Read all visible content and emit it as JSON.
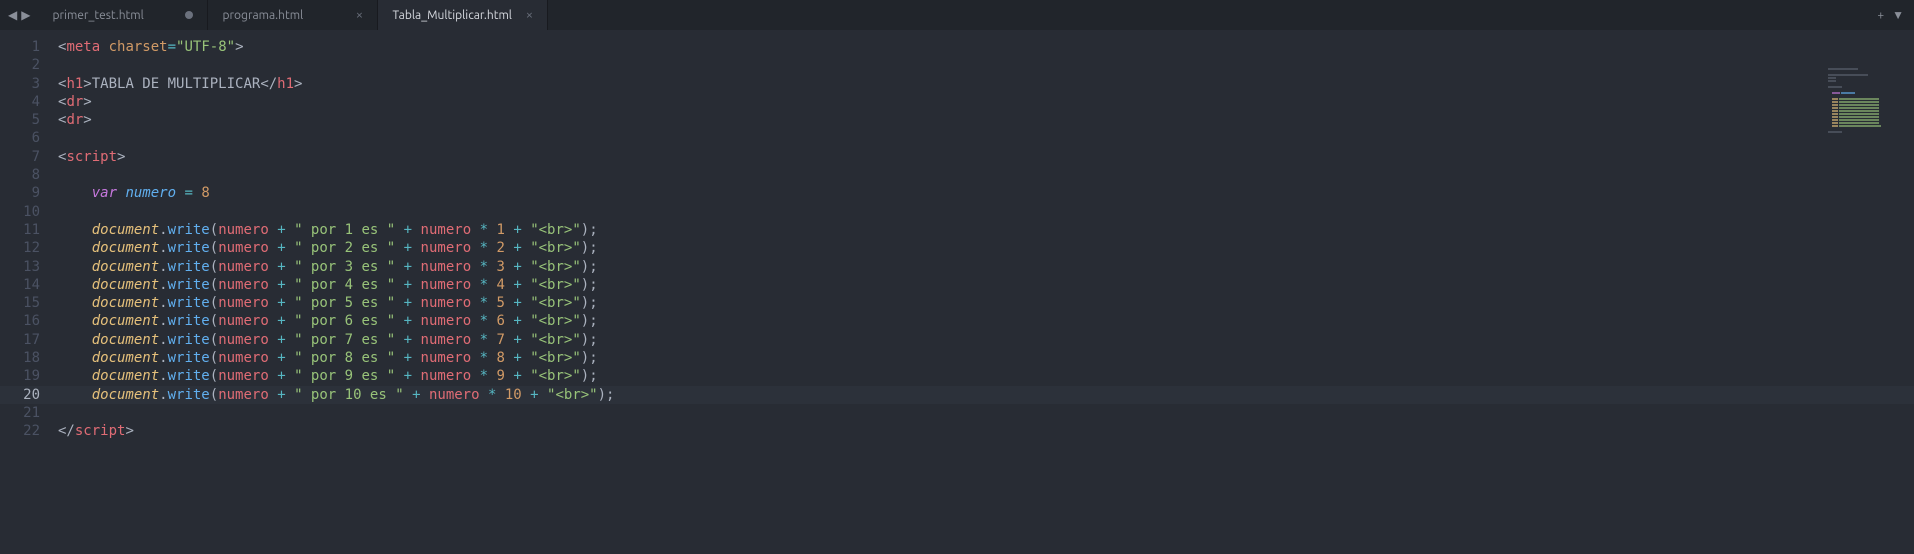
{
  "tabs": [
    {
      "label": "primer_test.html",
      "dirty": true,
      "active": false
    },
    {
      "label": "programa.html",
      "dirty": false,
      "active": false
    },
    {
      "label": "Tabla_Multiplicar.html",
      "dirty": false,
      "active": true
    }
  ],
  "nav": {
    "left": "◀",
    "right": "▶"
  },
  "tab_actions": {
    "new": "+",
    "menu": "▼",
    "close": "×"
  },
  "current_line": 20,
  "lines": [
    {
      "n": 1,
      "t": [
        [
          "<",
          "punc"
        ],
        [
          "meta",
          "tag"
        ],
        [
          " ",
          "text"
        ],
        [
          "charset",
          "attr"
        ],
        [
          "=",
          "op"
        ],
        [
          "\"UTF-8\"",
          "str"
        ],
        [
          ">",
          "punc"
        ]
      ]
    },
    {
      "n": 2,
      "t": []
    },
    {
      "n": 3,
      "t": [
        [
          "<",
          "punc"
        ],
        [
          "h1",
          "tag"
        ],
        [
          ">",
          "punc"
        ],
        [
          "TABLA DE MULTIPLICAR",
          "text"
        ],
        [
          "</",
          "punc"
        ],
        [
          "h1",
          "tag"
        ],
        [
          ">",
          "punc"
        ]
      ]
    },
    {
      "n": 4,
      "t": [
        [
          "<",
          "punc"
        ],
        [
          "dr",
          "tag"
        ],
        [
          ">",
          "punc"
        ]
      ]
    },
    {
      "n": 5,
      "t": [
        [
          "<",
          "punc"
        ],
        [
          "dr",
          "tag"
        ],
        [
          ">",
          "punc"
        ]
      ]
    },
    {
      "n": 6,
      "t": []
    },
    {
      "n": 7,
      "t": [
        [
          "<",
          "punc"
        ],
        [
          "script",
          "tag"
        ],
        [
          ">",
          "punc"
        ]
      ]
    },
    {
      "n": 8,
      "t": []
    },
    {
      "n": 9,
      "t": [
        [
          "    ",
          "text"
        ],
        [
          "var",
          "kw"
        ],
        [
          " ",
          "text"
        ],
        [
          "numero",
          "var"
        ],
        [
          " ",
          "text"
        ],
        [
          "=",
          "op"
        ],
        [
          " ",
          "text"
        ],
        [
          "8",
          "num"
        ]
      ]
    },
    {
      "n": 10,
      "t": []
    },
    {
      "n": 11,
      "t": [
        [
          "    ",
          "text"
        ],
        [
          "document",
          "obj"
        ],
        [
          ".",
          "punc"
        ],
        [
          "write",
          "func"
        ],
        [
          "(",
          "punc"
        ],
        [
          "numero",
          "param"
        ],
        [
          " ",
          "text"
        ],
        [
          "+",
          "op"
        ],
        [
          " ",
          "text"
        ],
        [
          "\" por 1 es \"",
          "str"
        ],
        [
          " ",
          "text"
        ],
        [
          "+",
          "op"
        ],
        [
          " ",
          "text"
        ],
        [
          "numero",
          "param"
        ],
        [
          " ",
          "text"
        ],
        [
          "*",
          "op"
        ],
        [
          " ",
          "text"
        ],
        [
          "1",
          "num"
        ],
        [
          " ",
          "text"
        ],
        [
          "+",
          "op"
        ],
        [
          " ",
          "text"
        ],
        [
          "\"<br>\"",
          "str"
        ],
        [
          ")",
          "punc"
        ],
        [
          ";",
          "punc"
        ]
      ]
    },
    {
      "n": 12,
      "t": [
        [
          "    ",
          "text"
        ],
        [
          "document",
          "obj"
        ],
        [
          ".",
          "punc"
        ],
        [
          "write",
          "func"
        ],
        [
          "(",
          "punc"
        ],
        [
          "numero",
          "param"
        ],
        [
          " ",
          "text"
        ],
        [
          "+",
          "op"
        ],
        [
          " ",
          "text"
        ],
        [
          "\" por 2 es \"",
          "str"
        ],
        [
          " ",
          "text"
        ],
        [
          "+",
          "op"
        ],
        [
          " ",
          "text"
        ],
        [
          "numero",
          "param"
        ],
        [
          " ",
          "text"
        ],
        [
          "*",
          "op"
        ],
        [
          " ",
          "text"
        ],
        [
          "2",
          "num"
        ],
        [
          " ",
          "text"
        ],
        [
          "+",
          "op"
        ],
        [
          " ",
          "text"
        ],
        [
          "\"<br>\"",
          "str"
        ],
        [
          ")",
          "punc"
        ],
        [
          ";",
          "punc"
        ]
      ]
    },
    {
      "n": 13,
      "t": [
        [
          "    ",
          "text"
        ],
        [
          "document",
          "obj"
        ],
        [
          ".",
          "punc"
        ],
        [
          "write",
          "func"
        ],
        [
          "(",
          "punc"
        ],
        [
          "numero",
          "param"
        ],
        [
          " ",
          "text"
        ],
        [
          "+",
          "op"
        ],
        [
          " ",
          "text"
        ],
        [
          "\" por 3 es \"",
          "str"
        ],
        [
          " ",
          "text"
        ],
        [
          "+",
          "op"
        ],
        [
          " ",
          "text"
        ],
        [
          "numero",
          "param"
        ],
        [
          " ",
          "text"
        ],
        [
          "*",
          "op"
        ],
        [
          " ",
          "text"
        ],
        [
          "3",
          "num"
        ],
        [
          " ",
          "text"
        ],
        [
          "+",
          "op"
        ],
        [
          " ",
          "text"
        ],
        [
          "\"<br>\"",
          "str"
        ],
        [
          ")",
          "punc"
        ],
        [
          ";",
          "punc"
        ]
      ]
    },
    {
      "n": 14,
      "t": [
        [
          "    ",
          "text"
        ],
        [
          "document",
          "obj"
        ],
        [
          ".",
          "punc"
        ],
        [
          "write",
          "func"
        ],
        [
          "(",
          "punc"
        ],
        [
          "numero",
          "param"
        ],
        [
          " ",
          "text"
        ],
        [
          "+",
          "op"
        ],
        [
          " ",
          "text"
        ],
        [
          "\" por 4 es \"",
          "str"
        ],
        [
          " ",
          "text"
        ],
        [
          "+",
          "op"
        ],
        [
          " ",
          "text"
        ],
        [
          "numero",
          "param"
        ],
        [
          " ",
          "text"
        ],
        [
          "*",
          "op"
        ],
        [
          " ",
          "text"
        ],
        [
          "4",
          "num"
        ],
        [
          " ",
          "text"
        ],
        [
          "+",
          "op"
        ],
        [
          " ",
          "text"
        ],
        [
          "\"<br>\"",
          "str"
        ],
        [
          ")",
          "punc"
        ],
        [
          ";",
          "punc"
        ]
      ]
    },
    {
      "n": 15,
      "t": [
        [
          "    ",
          "text"
        ],
        [
          "document",
          "obj"
        ],
        [
          ".",
          "punc"
        ],
        [
          "write",
          "func"
        ],
        [
          "(",
          "punc"
        ],
        [
          "numero",
          "param"
        ],
        [
          " ",
          "text"
        ],
        [
          "+",
          "op"
        ],
        [
          " ",
          "text"
        ],
        [
          "\" por 5 es \"",
          "str"
        ],
        [
          " ",
          "text"
        ],
        [
          "+",
          "op"
        ],
        [
          " ",
          "text"
        ],
        [
          "numero",
          "param"
        ],
        [
          " ",
          "text"
        ],
        [
          "*",
          "op"
        ],
        [
          " ",
          "text"
        ],
        [
          "5",
          "num"
        ],
        [
          " ",
          "text"
        ],
        [
          "+",
          "op"
        ],
        [
          " ",
          "text"
        ],
        [
          "\"<br>\"",
          "str"
        ],
        [
          ")",
          "punc"
        ],
        [
          ";",
          "punc"
        ]
      ]
    },
    {
      "n": 16,
      "t": [
        [
          "    ",
          "text"
        ],
        [
          "document",
          "obj"
        ],
        [
          ".",
          "punc"
        ],
        [
          "write",
          "func"
        ],
        [
          "(",
          "punc"
        ],
        [
          "numero",
          "param"
        ],
        [
          " ",
          "text"
        ],
        [
          "+",
          "op"
        ],
        [
          " ",
          "text"
        ],
        [
          "\" por 6 es \"",
          "str"
        ],
        [
          " ",
          "text"
        ],
        [
          "+",
          "op"
        ],
        [
          " ",
          "text"
        ],
        [
          "numero",
          "param"
        ],
        [
          " ",
          "text"
        ],
        [
          "*",
          "op"
        ],
        [
          " ",
          "text"
        ],
        [
          "6",
          "num"
        ],
        [
          " ",
          "text"
        ],
        [
          "+",
          "op"
        ],
        [
          " ",
          "text"
        ],
        [
          "\"<br>\"",
          "str"
        ],
        [
          ")",
          "punc"
        ],
        [
          ";",
          "punc"
        ]
      ]
    },
    {
      "n": 17,
      "t": [
        [
          "    ",
          "text"
        ],
        [
          "document",
          "obj"
        ],
        [
          ".",
          "punc"
        ],
        [
          "write",
          "func"
        ],
        [
          "(",
          "punc"
        ],
        [
          "numero",
          "param"
        ],
        [
          " ",
          "text"
        ],
        [
          "+",
          "op"
        ],
        [
          " ",
          "text"
        ],
        [
          "\" por 7 es \"",
          "str"
        ],
        [
          " ",
          "text"
        ],
        [
          "+",
          "op"
        ],
        [
          " ",
          "text"
        ],
        [
          "numero",
          "param"
        ],
        [
          " ",
          "text"
        ],
        [
          "*",
          "op"
        ],
        [
          " ",
          "text"
        ],
        [
          "7",
          "num"
        ],
        [
          " ",
          "text"
        ],
        [
          "+",
          "op"
        ],
        [
          " ",
          "text"
        ],
        [
          "\"<br>\"",
          "str"
        ],
        [
          ")",
          "punc"
        ],
        [
          ";",
          "punc"
        ]
      ]
    },
    {
      "n": 18,
      "t": [
        [
          "    ",
          "text"
        ],
        [
          "document",
          "obj"
        ],
        [
          ".",
          "punc"
        ],
        [
          "write",
          "func"
        ],
        [
          "(",
          "punc"
        ],
        [
          "numero",
          "param"
        ],
        [
          " ",
          "text"
        ],
        [
          "+",
          "op"
        ],
        [
          " ",
          "text"
        ],
        [
          "\" por 8 es \"",
          "str"
        ],
        [
          " ",
          "text"
        ],
        [
          "+",
          "op"
        ],
        [
          " ",
          "text"
        ],
        [
          "numero",
          "param"
        ],
        [
          " ",
          "text"
        ],
        [
          "*",
          "op"
        ],
        [
          " ",
          "text"
        ],
        [
          "8",
          "num"
        ],
        [
          " ",
          "text"
        ],
        [
          "+",
          "op"
        ],
        [
          " ",
          "text"
        ],
        [
          "\"<br>\"",
          "str"
        ],
        [
          ")",
          "punc"
        ],
        [
          ";",
          "punc"
        ]
      ]
    },
    {
      "n": 19,
      "t": [
        [
          "    ",
          "text"
        ],
        [
          "document",
          "obj"
        ],
        [
          ".",
          "punc"
        ],
        [
          "write",
          "func"
        ],
        [
          "(",
          "punc"
        ],
        [
          "numero",
          "param"
        ],
        [
          " ",
          "text"
        ],
        [
          "+",
          "op"
        ],
        [
          " ",
          "text"
        ],
        [
          "\" por 9 es \"",
          "str"
        ],
        [
          " ",
          "text"
        ],
        [
          "+",
          "op"
        ],
        [
          " ",
          "text"
        ],
        [
          "numero",
          "param"
        ],
        [
          " ",
          "text"
        ],
        [
          "*",
          "op"
        ],
        [
          " ",
          "text"
        ],
        [
          "9",
          "num"
        ],
        [
          " ",
          "text"
        ],
        [
          "+",
          "op"
        ],
        [
          " ",
          "text"
        ],
        [
          "\"<br>\"",
          "str"
        ],
        [
          ")",
          "punc"
        ],
        [
          ";",
          "punc"
        ]
      ]
    },
    {
      "n": 20,
      "t": [
        [
          "    ",
          "text"
        ],
        [
          "document",
          "obj"
        ],
        [
          ".",
          "punc"
        ],
        [
          "write",
          "func"
        ],
        [
          "(",
          "punc"
        ],
        [
          "numero",
          "param"
        ],
        [
          " ",
          "text"
        ],
        [
          "+",
          "op"
        ],
        [
          " ",
          "text"
        ],
        [
          "\" por 10 es \"",
          "str"
        ],
        [
          " ",
          "text"
        ],
        [
          "+",
          "op"
        ],
        [
          " ",
          "text"
        ],
        [
          "numero",
          "param"
        ],
        [
          " ",
          "text"
        ],
        [
          "*",
          "op"
        ],
        [
          " ",
          "text"
        ],
        [
          "10",
          "num"
        ],
        [
          " ",
          "text"
        ],
        [
          "+",
          "op"
        ],
        [
          " ",
          "text"
        ],
        [
          "\"<br>\"",
          "str"
        ],
        [
          ")",
          "punc"
        ],
        [
          ";",
          "punc"
        ]
      ]
    },
    {
      "n": 21,
      "t": []
    },
    {
      "n": 22,
      "t": [
        [
          "</",
          "punc"
        ],
        [
          "script",
          "tag"
        ],
        [
          ">",
          "punc"
        ]
      ]
    }
  ]
}
